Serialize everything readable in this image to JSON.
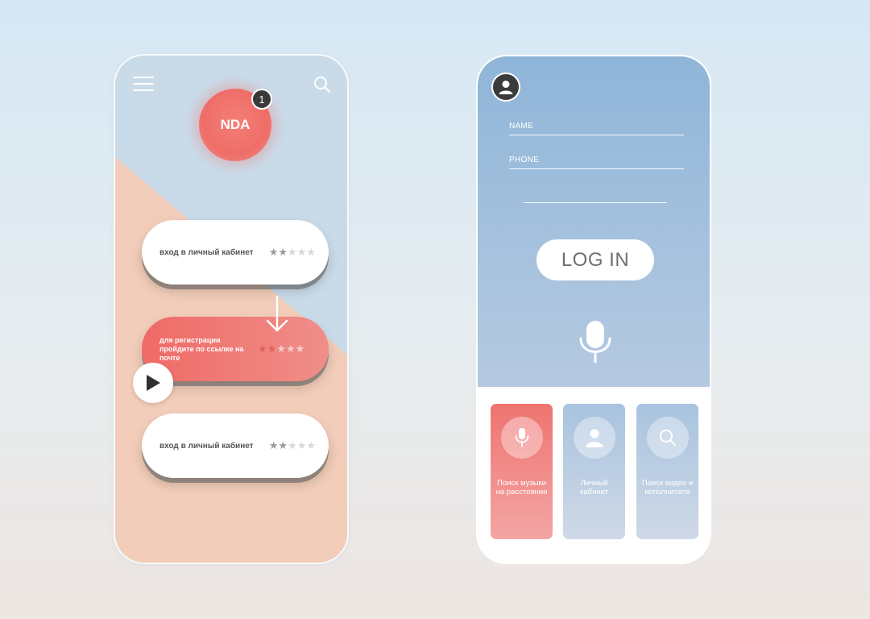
{
  "left_phone": {
    "nda": {
      "label": "NDA",
      "badge_count": "1"
    },
    "cards": [
      {
        "label": "вход в личный кабинет",
        "rating": 2,
        "max": 5
      },
      {
        "label": "для регистрации пройдите по ссылке на почте",
        "rating": 2,
        "max": 5
      },
      {
        "label": "вход в личный кабинет",
        "rating": 2,
        "max": 5
      }
    ],
    "icons": [
      "hamburger-menu-icon",
      "search-icon",
      "arrow-down-icon",
      "play-icon"
    ]
  },
  "right_phone": {
    "form": {
      "name_label": "NAME",
      "phone_label": "PHONE",
      "login_button": "LOG IN"
    },
    "tiles": [
      {
        "label": "Поиск музыки на расстоянии",
        "icon": "microphone-icon",
        "color": "#ef7370"
      },
      {
        "label": "Личный кабинет",
        "icon": "user-icon",
        "color": "#a8c3df"
      },
      {
        "label": "Поиск видео и исполнителя",
        "icon": "search-icon",
        "color": "#a8c3df"
      }
    ]
  },
  "colors": {
    "accent_red": "#ef6d68",
    "accent_blue": "#8eb5d8",
    "peach": "#f2cdb9"
  }
}
